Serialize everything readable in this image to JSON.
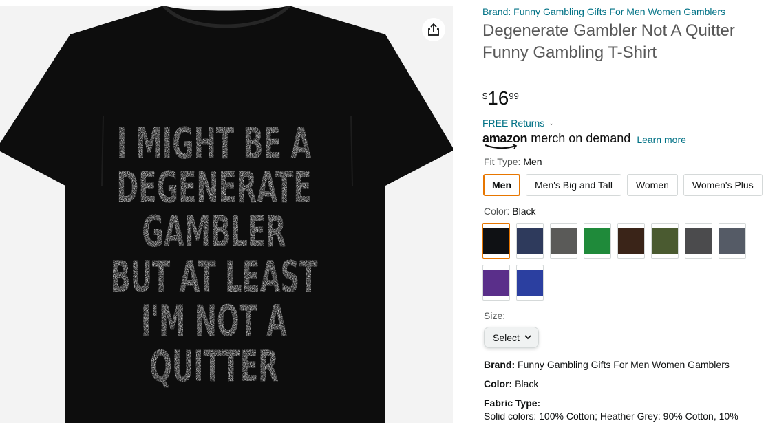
{
  "image": {
    "shirt_color": "#0d0d0d",
    "print_lines": [
      "I MIGHT BE A",
      "DEGENERATE",
      "GAMBLER",
      "BUT AT LEAST",
      "I'M NOT A",
      "QUITTER"
    ],
    "print_color": "#e4e4e4",
    "share_icon": "share-icon"
  },
  "product": {
    "brand_link": "Brand: Funny Gambling Gifts For Men Women Gamblers",
    "title": "Degenerate Gambler Not A Quitter Funny Gambling T-Shirt",
    "price": {
      "symbol": "$",
      "whole": "16",
      "fraction": "99"
    },
    "returns": "FREE Returns",
    "merch": {
      "logo_text": "amazon",
      "tagline": "merch on demand",
      "learn_more": "Learn more"
    }
  },
  "fit_type": {
    "label": "Fit Type:",
    "selected": "Men",
    "options": [
      "Men",
      "Men's Big and Tall",
      "Women",
      "Women's Plus"
    ]
  },
  "color": {
    "label": "Color:",
    "selected": "Black",
    "swatches": [
      "#0f1114",
      "#2e3a5c",
      "#5a5a58",
      "#1f8a3a",
      "#3a2418",
      "#4a5a30",
      "#4b4b4d",
      "#555b66",
      "#5a2f8a",
      "#2b3fa0"
    ]
  },
  "size": {
    "label": "Size:",
    "select_label": "Select"
  },
  "attributes": {
    "brand_key": "Brand:",
    "brand_value": "Funny Gambling Gifts For Men Women Gamblers",
    "color_key": "Color:",
    "color_value": "Black",
    "fabric_key": "Fabric Type:",
    "fabric_value": "Solid colors: 100% Cotton; Heather Grey: 90% Cotton, 10%"
  }
}
